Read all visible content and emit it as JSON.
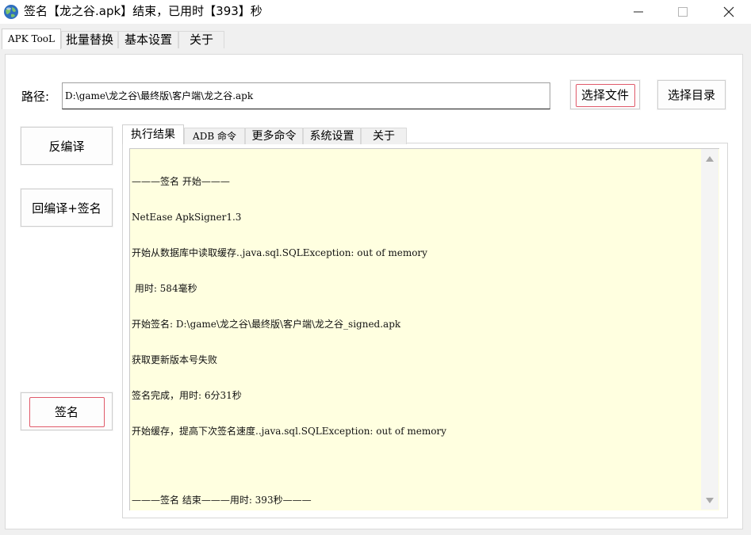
{
  "window": {
    "title": "签名【龙之谷.apk】结束，已用时【393】秒",
    "app_icon": "globe-icon",
    "controls": [
      "minimize-icon",
      "maximize-icon",
      "close-icon"
    ]
  },
  "top_tabs": [
    {
      "label": "APK TooL",
      "active": true
    },
    {
      "label": "批量替换",
      "active": false
    },
    {
      "label": "基本设置",
      "active": false
    },
    {
      "label": "关于",
      "active": false
    }
  ],
  "path": {
    "label": "路径:",
    "value": "D:\\game\\龙之谷\\最终版\\客户端\\龙之谷.apk"
  },
  "buttons": {
    "choose_file": "选择文件",
    "choose_dir": "选择目录",
    "decompile": "反编译",
    "recompile_sign": "回编译+签名",
    "sign": "签名"
  },
  "inner_tabs": [
    {
      "label": "执行结果",
      "active": true
    },
    {
      "label": "ADB 命令",
      "active": false
    },
    {
      "label": "更多命令",
      "active": false
    },
    {
      "label": "系统设置",
      "active": false
    },
    {
      "label": "关于",
      "active": false
    }
  ],
  "log": {
    "lines": [
      "———签名 开始———",
      "NetEase ApkSigner1.3",
      "开始从数据库中读取缓存..java.sql.SQLException: out of memory",
      " 用时: 584毫秒",
      "开始签名: D:\\game\\龙之谷\\最终版\\客户端\\龙之谷_signed.apk",
      "获取更新版本号失败",
      "签名完成，用时: 6分31秒",
      "开始缓存，提高下次签名速度..java.sql.SQLException: out of memory",
      "",
      "———签名 结束———用时: 393秒———"
    ]
  },
  "colors": {
    "log_background": "#ffffe0",
    "focus_border": "#e05a6a",
    "window_background": "#f0f0f0"
  }
}
